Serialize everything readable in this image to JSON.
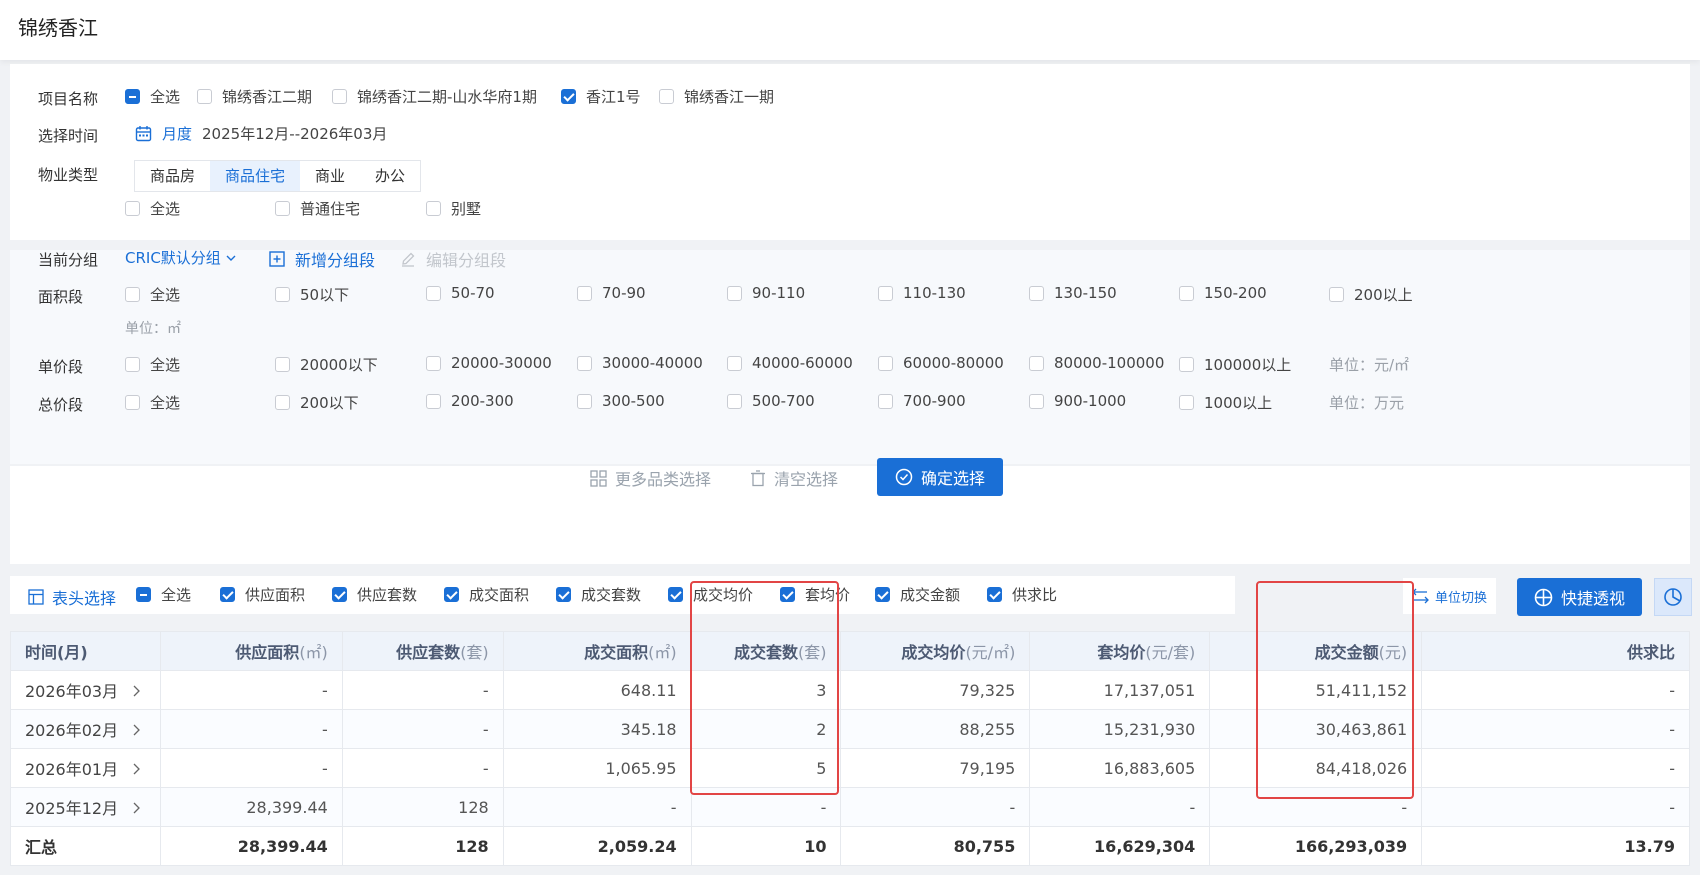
{
  "page_title": "锦绣香江",
  "project": {
    "label": "项目名称",
    "options": [
      {
        "text": "全选",
        "state": "partial"
      },
      {
        "text": "锦绣香江二期",
        "state": "unchecked"
      },
      {
        "text": "锦绣香江二期-山水华府1期",
        "state": "unchecked"
      },
      {
        "text": "香江1号",
        "state": "checked"
      },
      {
        "text": "锦绣香江一期",
        "state": "unchecked"
      }
    ]
  },
  "time": {
    "label": "选择时间",
    "mode": "月度",
    "range": "2025年12月--2026年03月"
  },
  "property": {
    "label": "物业类型",
    "tabs": [
      "商品房",
      "商品住宅",
      "商业",
      "办公"
    ],
    "active_tab": "商品住宅",
    "sub_options": [
      "全选",
      "普通住宅",
      "别墅"
    ]
  },
  "group": {
    "label": "当前分组",
    "value": "CRIC默认分组",
    "add": "新增分组段",
    "edit": "编辑分组段"
  },
  "area": {
    "label": "面积段",
    "options": [
      "全选",
      "50以下",
      "50-70",
      "70-90",
      "90-110",
      "110-130",
      "130-150",
      "150-200",
      "200以上"
    ],
    "unit": "单位：㎡"
  },
  "price": {
    "label": "单价段",
    "options": [
      "全选",
      "20000以下",
      "20000-30000",
      "30000-40000",
      "40000-60000",
      "60000-80000",
      "80000-100000",
      "100000以上"
    ],
    "unit": "单位：元/㎡"
  },
  "total_price": {
    "label": "总价段",
    "options": [
      "全选",
      "200以下",
      "200-300",
      "300-500",
      "500-700",
      "700-900",
      "900-1000",
      "1000以上"
    ],
    "unit": "单位：万元"
  },
  "actions": {
    "more": "更多品类选择",
    "clear": "清空选择",
    "confirm": "确定选择"
  },
  "columns_selector": {
    "label": "表头选择",
    "options": [
      {
        "text": "全选",
        "state": "partial"
      },
      {
        "text": "供应面积",
        "state": "checked"
      },
      {
        "text": "供应套数",
        "state": "checked"
      },
      {
        "text": "成交面积",
        "state": "checked"
      },
      {
        "text": "成交套数",
        "state": "checked"
      },
      {
        "text": "成交均价",
        "state": "checked"
      },
      {
        "text": "套均价",
        "state": "checked"
      },
      {
        "text": "成交金额",
        "state": "checked"
      },
      {
        "text": "供求比",
        "state": "checked"
      }
    ]
  },
  "toolbar": {
    "unit_switch": "单位切换",
    "quick_view": "快捷透视"
  },
  "table": {
    "headers": [
      {
        "name": "时间(月)",
        "unit": ""
      },
      {
        "name": "供应面积",
        "unit": "(㎡)"
      },
      {
        "name": "供应套数",
        "unit": "(套)"
      },
      {
        "name": "成交面积",
        "unit": "(㎡)"
      },
      {
        "name": "成交套数",
        "unit": "(套)"
      },
      {
        "name": "成交均价",
        "unit": "(元/㎡)"
      },
      {
        "name": "套均价",
        "unit": "(元/套)"
      },
      {
        "name": "成交金额",
        "unit": "(元)"
      },
      {
        "name": "供求比",
        "unit": ""
      }
    ],
    "rows": [
      [
        "2026年03月",
        "-",
        "-",
        "648.11",
        "3",
        "79,325",
        "17,137,051",
        "51,411,152",
        "-"
      ],
      [
        "2026年02月",
        "-",
        "-",
        "345.18",
        "2",
        "88,255",
        "15,231,930",
        "30,463,861",
        "-"
      ],
      [
        "2026年01月",
        "-",
        "-",
        "1,065.95",
        "5",
        "79,195",
        "16,883,605",
        "84,418,026",
        "-"
      ],
      [
        "2025年12月",
        "28,399.44",
        "128",
        "-",
        "-",
        "-",
        "-",
        "-",
        "-"
      ]
    ],
    "total": [
      "汇总",
      "28,399.44",
      "128",
      "2,059.24",
      "10",
      "80,755",
      "16,629,304",
      "166,293,039",
      "13.79"
    ]
  },
  "colors": {
    "primary": "#1a6fd6",
    "highlight": "#e24545"
  }
}
